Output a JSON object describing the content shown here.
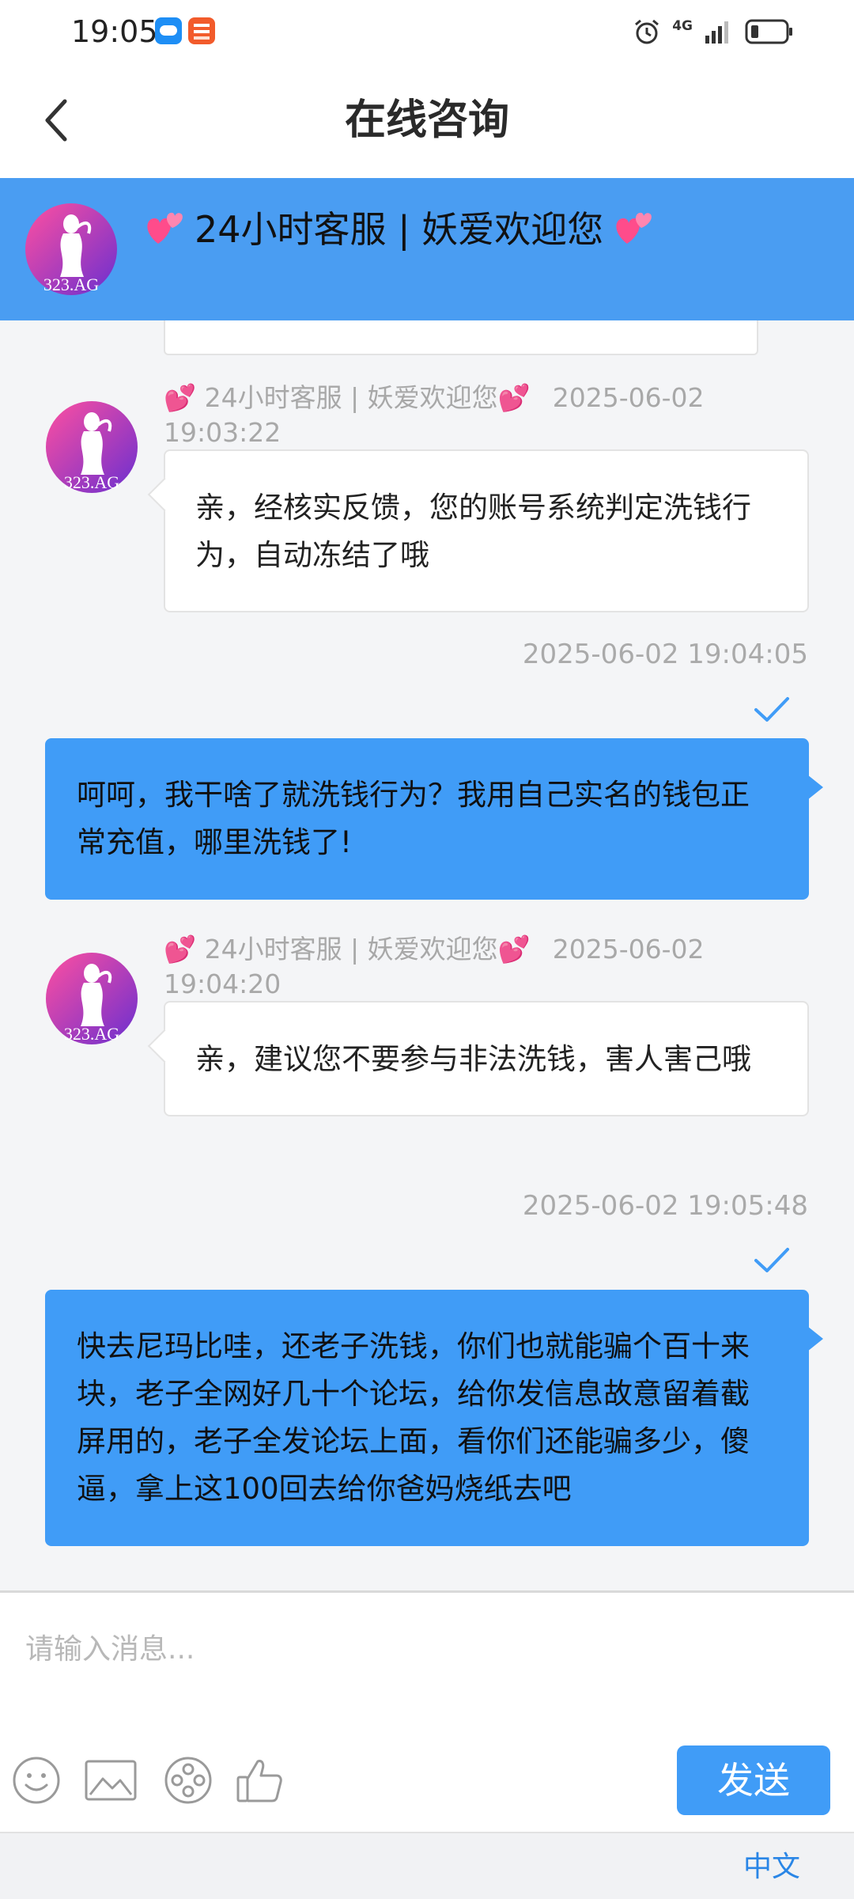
{
  "status_bar": {
    "time": "19:05",
    "network": "4G"
  },
  "header": {
    "title": "在线咨询"
  },
  "banner": {
    "title": "24小时客服 | 妖爱欢迎您",
    "avatar_text": "323.AG"
  },
  "messages": [
    {
      "sender": "💕 24小时客服 | 妖爱欢迎您💕",
      "time": "2025-06-02 19:03:22",
      "text": "亲，经核实反馈，您的账号系统判定洗钱行为，自动冻结了哦"
    },
    {
      "time": "2025-06-02 19:04:05",
      "text": "呵呵，我干啥了就洗钱行为？我用自己实名的钱包正常充值，哪里洗钱了!"
    },
    {
      "sender": "💕 24小时客服 | 妖爱欢迎您💕",
      "time": "2025-06-02 19:04:20",
      "text": "亲，建议您不要参与非法洗钱，害人害己哦"
    },
    {
      "time": "2025-06-02 19:05:48",
      "text": "快去尼玛比哇，还老子洗钱，你们也就能骗个百十来块，老子全网好几十个论坛，给你发信息故意留着截屏用的，老子全发论坛上面，看你们还能骗多少，傻逼，拿上这100回去给你爸妈烧纸去吧"
    }
  ],
  "input": {
    "placeholder": "请输入消息...",
    "value": ""
  },
  "toolbar": {
    "icons": [
      "emoji-icon",
      "image-icon",
      "video-icon",
      "thumbs-up-icon"
    ],
    "send_label": "发送"
  },
  "footer": {
    "language": "中文"
  },
  "colors": {
    "accent_blue": "#409cf7",
    "banner_blue": "#4a9df2",
    "avatar_gradient": [
      "#ff4fa0",
      "#6a2fd0"
    ]
  }
}
